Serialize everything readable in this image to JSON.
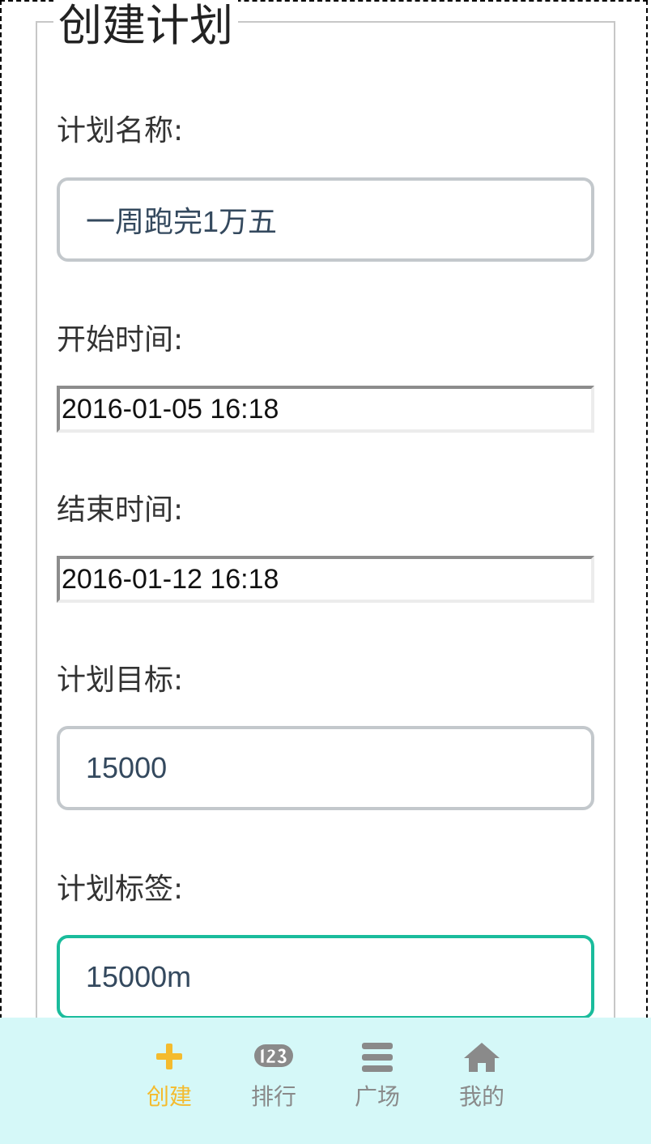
{
  "form": {
    "legend": "创建计划",
    "plan_name_label": "计划名称:",
    "plan_name_value": "一周跑完1万五",
    "start_time_label": "开始时间:",
    "start_time_value": "2016-01-05 16:18",
    "end_time_label": "结束时间:",
    "end_time_value": "2016-01-12 16:18",
    "goal_label": "计划目标:",
    "goal_value": "15000",
    "tag_label": "计划标签:",
    "tag_value": "15000m"
  },
  "tabbar": {
    "items": [
      {
        "label": "创建",
        "icon": "plus-icon",
        "active": true
      },
      {
        "label": "排行",
        "icon": "number-123-icon",
        "active": false
      },
      {
        "label": "广场",
        "icon": "menu-icon",
        "active": false
      },
      {
        "label": "我的",
        "icon": "home-icon",
        "active": false
      }
    ]
  },
  "colors": {
    "accent_active": "#f4bb2e",
    "focus_border": "#1abc9c",
    "tabbar_bg": "#d5f8f8",
    "inactive": "#8a8a8a"
  }
}
